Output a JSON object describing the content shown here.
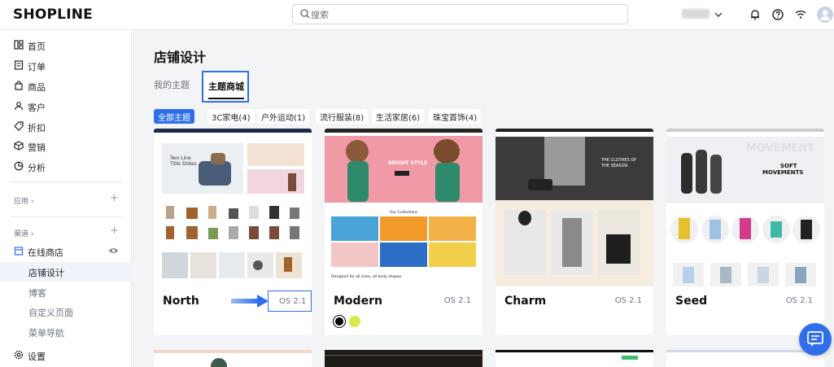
{
  "header": {
    "logo": "SHOPLINE",
    "search_placeholder": "搜索"
  },
  "sidebar": {
    "items": [
      {
        "label": "首页",
        "icon": "grid-icon"
      },
      {
        "label": "订单",
        "icon": "orders-icon"
      },
      {
        "label": "商品",
        "icon": "bag-icon"
      },
      {
        "label": "客户",
        "icon": "person-icon"
      },
      {
        "label": "折扣",
        "icon": "tag-icon"
      },
      {
        "label": "营销",
        "icon": "cube-icon"
      },
      {
        "label": "分析",
        "icon": "chart-icon"
      }
    ],
    "apps_section": "应用",
    "channels_section": "渠道",
    "online_store": "在线商店",
    "sub_items": [
      "店铺设计",
      "博客",
      "自定义页面",
      "菜单导航"
    ],
    "settings": "设置"
  },
  "main": {
    "title": "店铺设计",
    "tabs": [
      "我的主题",
      "主题商城"
    ],
    "filters": [
      "全部主题",
      "3C家电(4)",
      "户外运动(1)",
      "流行服装(8)",
      "生活家居(6)",
      "珠宝首饰(4)"
    ],
    "themes": [
      {
        "name": "North",
        "version": "OS 2.1"
      },
      {
        "name": "Modern",
        "version": "OS 2.1",
        "swatches": [
          "#000000",
          "#d6ea4e"
        ]
      },
      {
        "name": "Charm",
        "version": "OS 2.1"
      },
      {
        "name": "Seed",
        "version": "OS 2.1"
      }
    ],
    "thumb_text": {
      "north_hero": "Two Line\nTitle Slides",
      "modern_hero": "BRIGHT STYLE",
      "modern_collections": "Our Collections",
      "modern_desc": "Designed for all sizes, all body shapes",
      "charm_hero": "THE CLOTHES OF\nTHE SEASON.",
      "seed_hero": "SOFT\nMOVEMENTS",
      "seed_bg": "MOVEMENT"
    }
  },
  "colors": {
    "accent": "#2f6feb",
    "sidebar_active_bg": "#f0f3f8"
  }
}
